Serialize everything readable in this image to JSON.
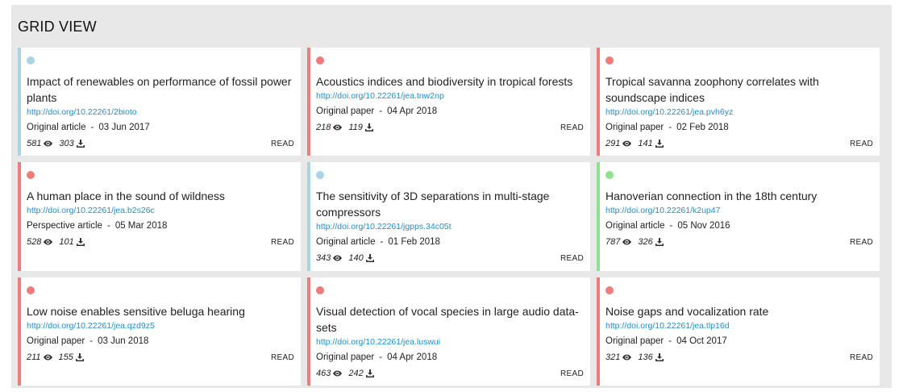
{
  "panel_title": "GRID VIEW",
  "colors": {
    "blue": "#a9d4e2",
    "red": "#ef7b7b",
    "green": "#8fe08f",
    "link": "#1a8fd6"
  },
  "read_label": "READ",
  "cards": [
    {
      "color": "blue",
      "title": "Impact of renewables on performance of fossil power plants",
      "doi": "http://doi.org/10.22261/2bioto",
      "type": "Original article",
      "date": "03 Jun 2017",
      "views": "581",
      "downloads": "303"
    },
    {
      "color": "red",
      "title": "Acoustics indices and biodiversity in tropical forests",
      "doi": "http://doi.org/10.22261/jea.tnw2np",
      "type": "Original paper",
      "date": "04 Apr 2018",
      "views": "218",
      "downloads": "119"
    },
    {
      "color": "red",
      "title": "Tropical savanna zoophony correlates with soundscape indices",
      "doi": "http://doi.org/10.22261/jea.pvh6yz",
      "type": "Original paper",
      "date": "02 Feb 2018",
      "views": "291",
      "downloads": "141"
    },
    {
      "color": "red",
      "title": "A human place in the sound of wildness",
      "doi": "http://doi.org/10.22261/jea.b2s26c",
      "type": "Perspective article",
      "date": "05 Mar 2018",
      "views": "528",
      "downloads": "101"
    },
    {
      "color": "blue",
      "title": "The sensitivity of 3D separations in multi-stage compressors",
      "doi": "http://doi.org/10.22261/jgpps.34c05t",
      "type": "Original article",
      "date": "01 Feb 2018",
      "views": "343",
      "downloads": "140"
    },
    {
      "color": "green",
      "title": "Hanoverian connection in the 18th century",
      "doi": "http://doi.org/10.22261/k2up47",
      "type": "Original article",
      "date": "05 Nov 2016",
      "views": "787",
      "downloads": "326"
    },
    {
      "color": "red",
      "title": "Low noise enables sensitive beluga hearing",
      "doi": "http://doi.org/10.22261/jea.qzd9z5",
      "type": "Original paper",
      "date": "03 Jun 2018",
      "views": "211",
      "downloads": "155"
    },
    {
      "color": "red",
      "title": "Visual detection of vocal species in large audio data-sets",
      "doi": "http://doi.org/10.22261/jea.luswui",
      "type": "Original paper",
      "date": "04 Apr 2018",
      "views": "463",
      "downloads": "242"
    },
    {
      "color": "red",
      "title": "Noise gaps and vocalization rate",
      "doi": "http://doi.org/10.22261/jea.tlp16d",
      "type": "Original paper",
      "date": "04 Oct 2017",
      "views": "321",
      "downloads": "136"
    }
  ]
}
